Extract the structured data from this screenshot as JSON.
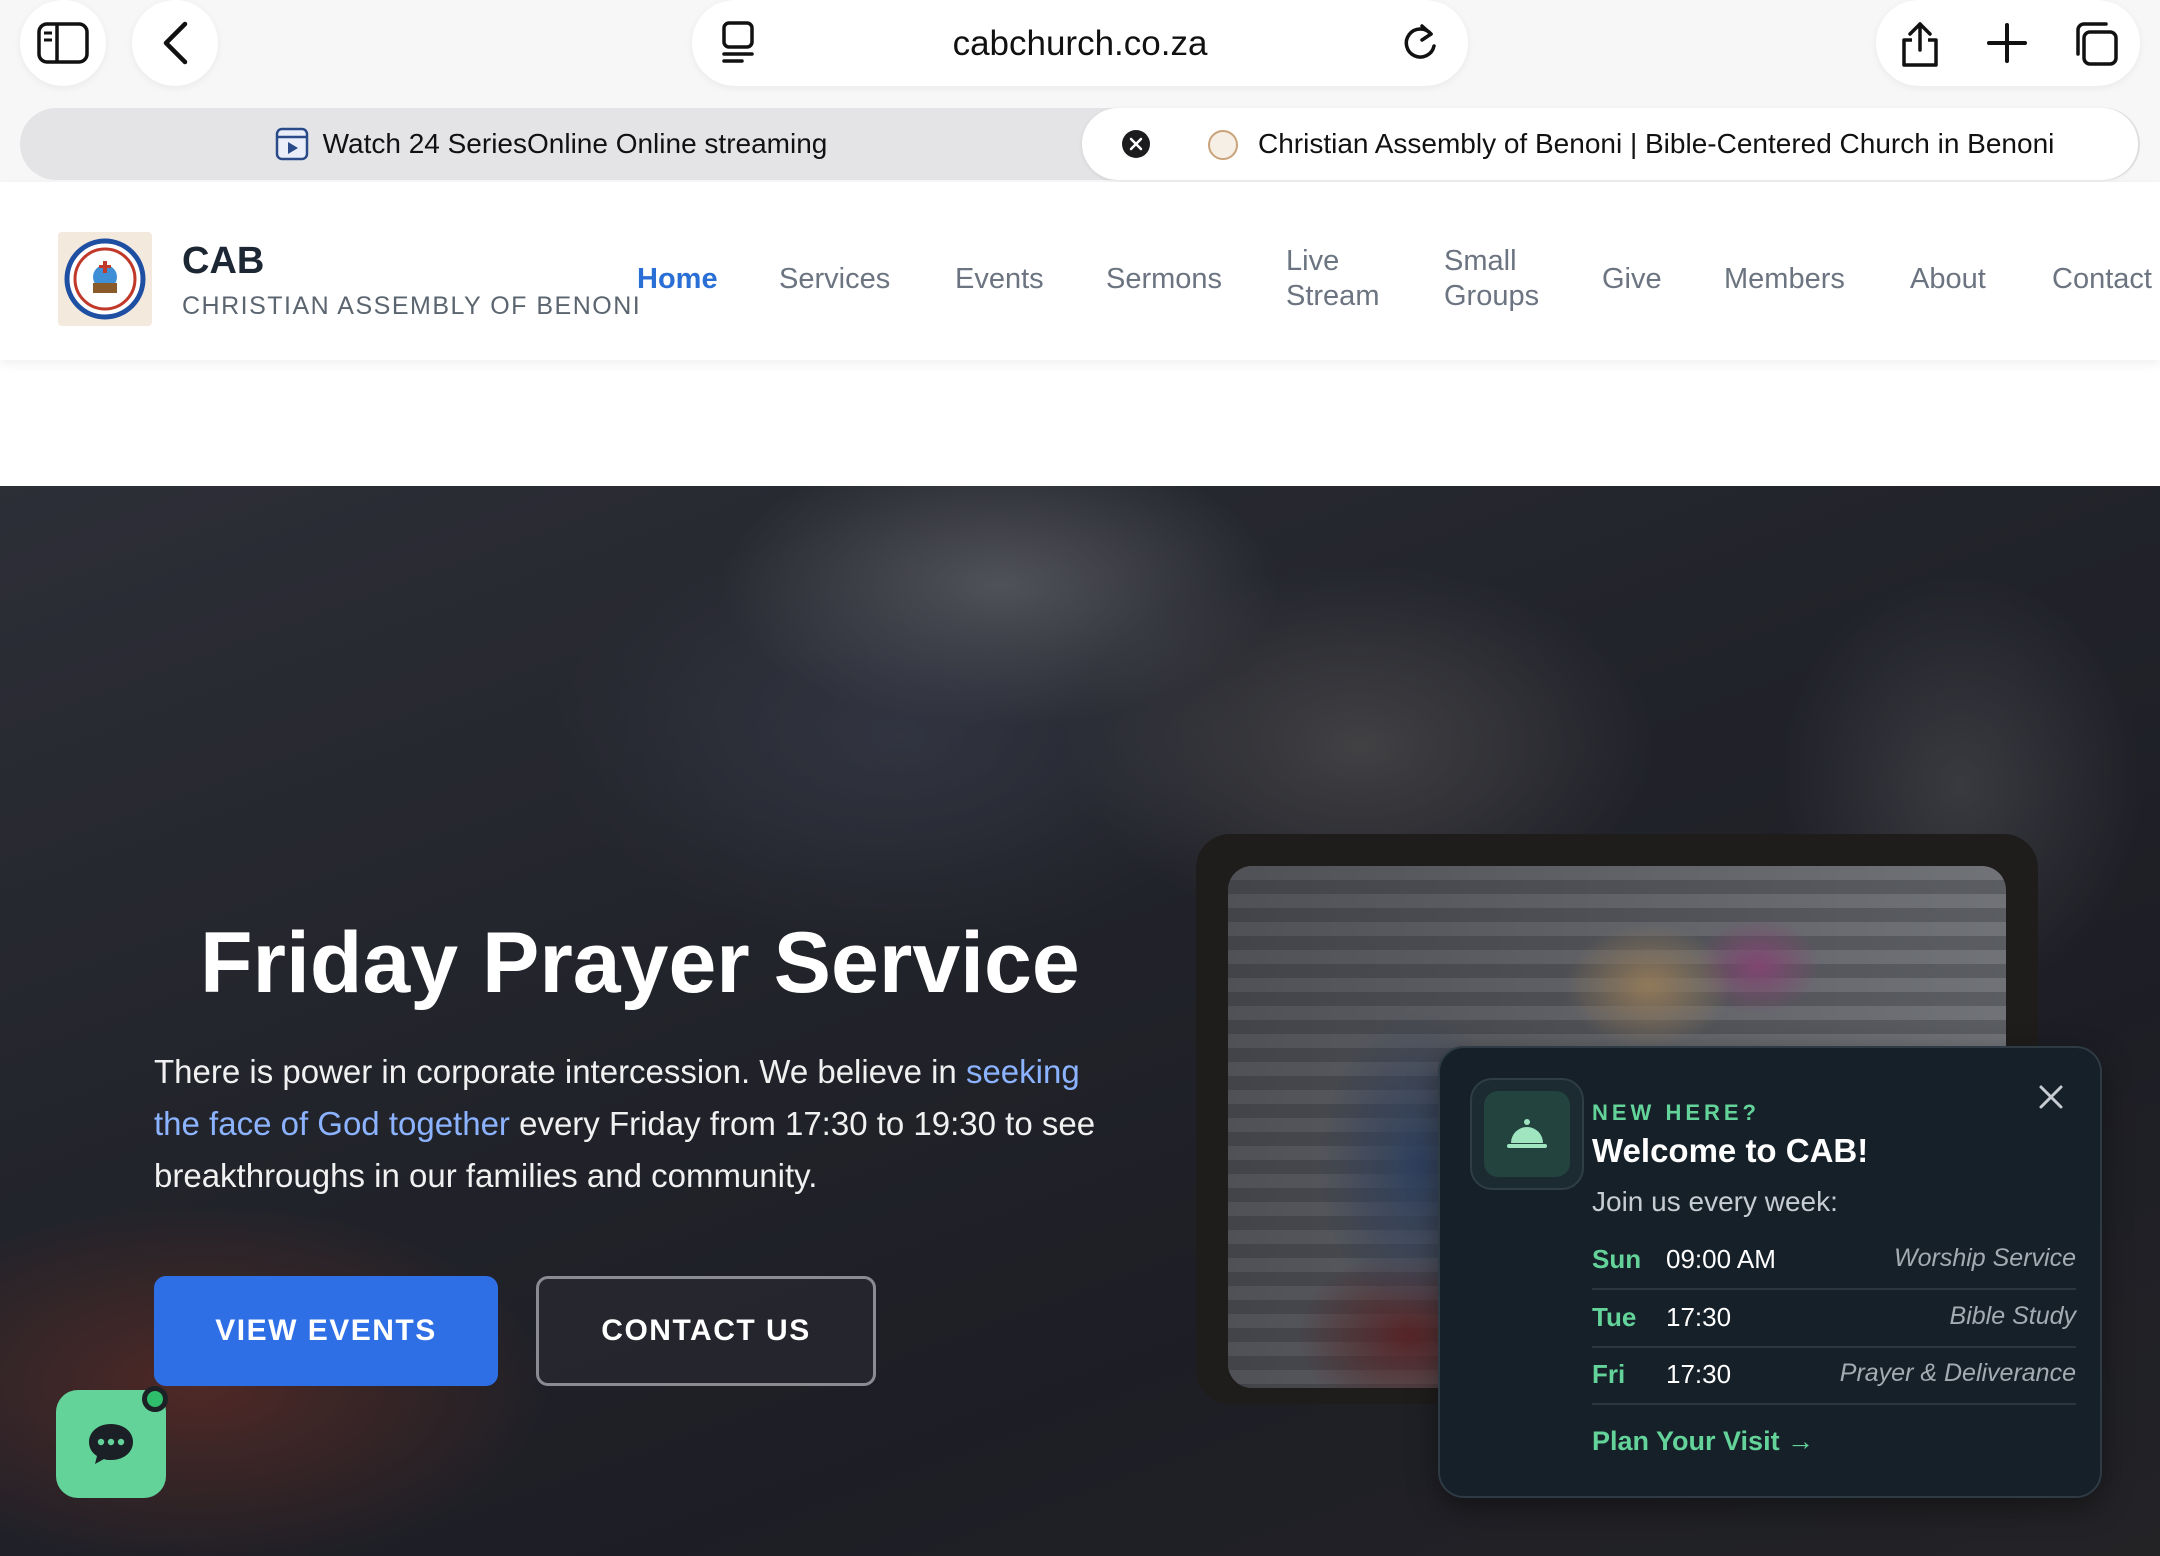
{
  "browser": {
    "url": "cabchurch.co.za",
    "tabs": [
      {
        "title": "Watch 24 SeriesOnline Online streaming",
        "active": false
      },
      {
        "title": "Christian Assembly of Benoni | Bible-Centered Church in Benoni",
        "active": true
      }
    ],
    "icons": [
      "sidebar-icon",
      "back-icon",
      "reader-icon",
      "reload-icon",
      "share-icon",
      "new-tab-icon",
      "tabs-overview-icon"
    ]
  },
  "site": {
    "brand": {
      "name": "CAB",
      "subtitle": "CHRISTIAN ASSEMBLY OF BENONI"
    },
    "nav": [
      {
        "label": "Home",
        "active": true
      },
      {
        "label": "Services"
      },
      {
        "label": "Events"
      },
      {
        "label": "Sermons"
      },
      {
        "label": "Live",
        "label2": "Stream"
      },
      {
        "label": "Small",
        "label2": "Groups"
      },
      {
        "label": "Give"
      },
      {
        "label": "Members"
      },
      {
        "label": "About"
      },
      {
        "label": "Contact"
      }
    ]
  },
  "hero": {
    "title": "Friday Prayer Service",
    "text_before": "There is power in corporate intercession. We believe in ",
    "text_highlight": "seeking the face of God together",
    "text_after": " every Friday from 17:30 to 19:30 to see breakthroughs in our families and community.",
    "primary_button": "VIEW EVENTS",
    "secondary_button": "CONTACT US"
  },
  "welcome": {
    "kicker": "NEW HERE?",
    "title": "Welcome to CAB!",
    "subtitle": "Join us every week:",
    "schedule": [
      {
        "day": "Sun",
        "time": "09:00 AM",
        "what": "Worship Service"
      },
      {
        "day": "Tue",
        "time": "17:30",
        "what": "Bible Study"
      },
      {
        "day": "Fri",
        "time": "17:30",
        "what": "Prayer & Deliverance"
      }
    ],
    "link": "Plan Your Visit →"
  },
  "colors": {
    "accent": "#2a6fd6",
    "button_primary": "#2f6fe6",
    "green": "#63d39a",
    "popup_bg": "#152028"
  }
}
